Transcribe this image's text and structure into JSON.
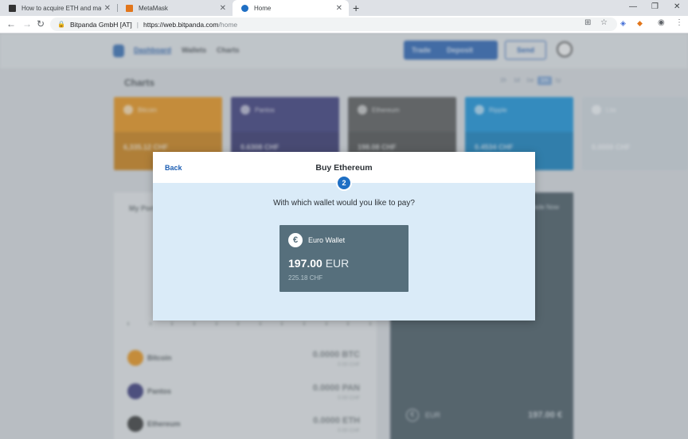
{
  "browser": {
    "tabs": [
      {
        "title": "How to acquire ETH and make a",
        "favicon_color": "#333333"
      },
      {
        "title": "MetaMask",
        "favicon_color": "#e2761b"
      },
      {
        "title": "Home",
        "favicon_color": "#1f6fc4"
      }
    ],
    "new_tab": "+",
    "window_controls": [
      "—",
      "❐",
      "✕"
    ],
    "address": {
      "org": "Bitpanda GmbH [AT]",
      "host": "https://web.bitpanda.com",
      "path": "/home"
    },
    "nav": {
      "back": "←",
      "forward": "→",
      "reload": "↻"
    }
  },
  "app": {
    "nav": {
      "dashboard": "Dashboard",
      "wallets": "Wallets",
      "charts": "Charts"
    },
    "actions": {
      "trade": "Trade",
      "deposit": "Deposit",
      "send": "Send"
    },
    "charts_title": "Charts",
    "ranges": [
      "1h",
      "1d",
      "1w",
      "1m",
      "1y"
    ],
    "cards": [
      {
        "name": "Bitcoin",
        "value": "6,335.12 CHF",
        "color": "#e2911e"
      },
      {
        "name": "Pantos",
        "value": "0.6308 CHF",
        "color": "#3e3d7a"
      },
      {
        "name": "Ethereum",
        "value": "198.08 CHF",
        "color": "#5a5a5a"
      },
      {
        "name": "Ripple",
        "value": "0.4534 CHF",
        "color": "#1b8fd3"
      },
      {
        "name": "Lite",
        "value": "0.0000 CHF",
        "color": "#c9d0d6"
      }
    ],
    "portfolio_title": "My Portfolio",
    "right_panel_title": "Trade Now",
    "assets": [
      {
        "name": "Bitcoin",
        "amount": "0.0000 BTC",
        "sub": "0.00 CHF",
        "color": "#e2911e"
      },
      {
        "name": "Pantos",
        "amount": "0.0000 PAN",
        "sub": "0.00 CHF",
        "color": "#3e3d7a"
      },
      {
        "name": "Ethereum",
        "amount": "0.0000 ETH",
        "sub": "0.00 CHF",
        "color": "#3d3d3d"
      }
    ],
    "eur_row": {
      "icon": "€",
      "label": "EUR",
      "amount": "197.00 €"
    }
  },
  "modal": {
    "back_label": "Back",
    "title": "Buy Ethereum",
    "step": "2",
    "question": "With which wallet would you like to pay?",
    "wallet": {
      "icon": "€",
      "name": "Euro Wallet",
      "balance_value": "197.00",
      "balance_currency": "EUR",
      "fiat_value": "225.18 CHF"
    }
  }
}
